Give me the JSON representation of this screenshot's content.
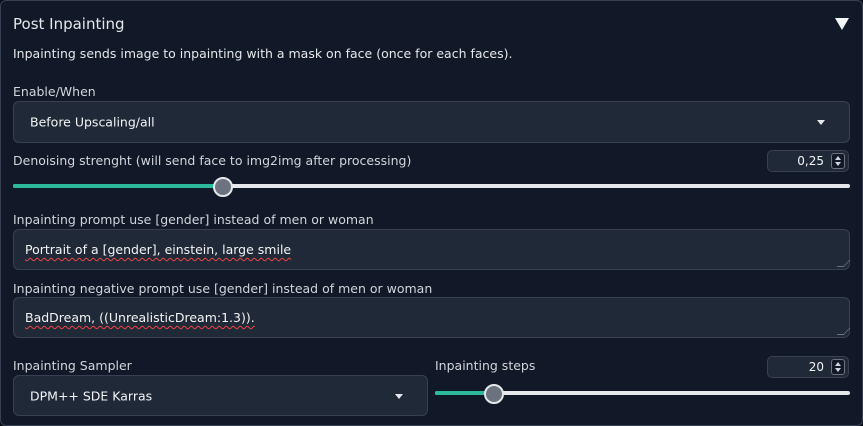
{
  "panel": {
    "title": "Post Inpainting",
    "description": "Inpainting sends image to inpainting with a mask on face (once for each faces)."
  },
  "enable": {
    "label": "Enable/When",
    "value": "Before Upscaling/all"
  },
  "denoising": {
    "label": "Denoising strenght (will send face to img2img after processing)",
    "value": "0,25",
    "fraction": 0.25
  },
  "prompt": {
    "label": "Inpainting prompt use [gender] instead of men or woman",
    "value": "Portrait of a [gender], einstein, large smile"
  },
  "negative_prompt": {
    "label": "Inpainting negative prompt use [gender] instead of men or woman",
    "value": "BadDream, ((UnrealisticDream:1.3))."
  },
  "sampler": {
    "label": "Inpainting Sampler",
    "value": "DPM++ SDE Karras"
  },
  "steps": {
    "label": "Inpainting steps",
    "value": "20",
    "fraction": 0.14
  },
  "colors": {
    "accent": "#2dba9c",
    "background": "#0b0f19",
    "input": "#1f2937"
  }
}
